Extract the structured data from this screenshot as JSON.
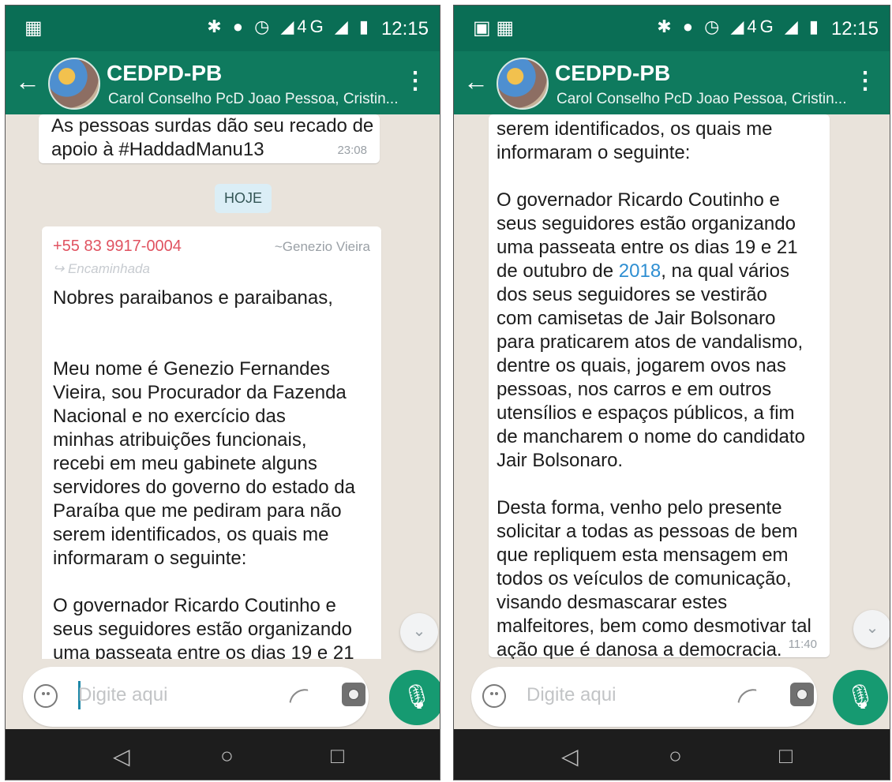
{
  "left": {
    "status": {
      "time": "12:15",
      "network": "4G"
    },
    "chat": {
      "title": "CEDPD-PB",
      "subtitle": "Carol Conselho PcD Joao Pessoa, Cristin...",
      "first_message": {
        "text": "As pessoas surdas dão seu recado de\napoio à #HaddadManu13",
        "time": "23:08"
      },
      "date_chip": "HOJE",
      "forwarded_message": {
        "phone": "+55 83 9917-0004",
        "alias": "~Genezio Vieira",
        "forwarded_label": "Encaminhada",
        "body": "Nobres paraibanos e paraibanas,\n\n\nMeu nome é Genezio Fernandes\nVieira, sou Procurador da Fazenda\nNacional e no exercício das\nminhas atribuições funcionais,\nrecebi em meu gabinete alguns\nservidores do governo do estado da\nParaíba que me pediram para não\nserem identificados, os quais me\ninformaram o seguinte:\n\nO governador Ricardo Coutinho e\nseus seguidores estão organizando\numa passeata entre os dias 19 e 21"
      }
    },
    "input": {
      "placeholder": "Digite aqui"
    }
  },
  "right": {
    "status": {
      "time": "12:15",
      "network": "4G"
    },
    "chat": {
      "title": "CEDPD-PB",
      "subtitle": "Carol Conselho PcD Joao Pessoa, Cristin...",
      "message": {
        "text_before_link": "serem identificados, os quais me\ninformaram o seguinte:\n\nO governador Ricardo Coutinho e\nseus seguidores estão organizando\numa passeata entre os dias 19 e 21\nde outubro de ",
        "link_text": "2018",
        "text_after_link": ", na qual vários\ndos seus seguidores se vestirão\ncom camisetas de Jair Bolsonaro\npara praticarem atos de vandalismo,\ndentre os quais, jogarem ovos nas\npessoas, nos carros e em outros\nutensílios e espaços públicos, a fim\nde mancharem o nome do candidato\nJair Bolsonaro.\n\nDesta forma, venho pelo presente\nsolicitar a todas as pessoas de bem\nque repliquem esta mensagem em\ntodos os veículos de comunicação,\nvisando desmascarar estes\nmalfeitores, bem como desmotivar tal\nação que é danosa a democracia.",
        "time": "11:40"
      }
    },
    "input": {
      "placeholder": "Digite aqui"
    }
  },
  "colors": {
    "header": "#0f7a5e",
    "sender": "#e05260",
    "link": "#2f8fd2",
    "mic": "#169a71"
  },
  "icons": [
    "back-arrow-icon",
    "group-avatar-icon",
    "overflow-menu-icon",
    "emoji-icon",
    "attach-icon",
    "camera-icon",
    "mic-icon",
    "scroll-down-icon",
    "nav-back-icon",
    "nav-home-icon",
    "nav-recent-icon"
  ]
}
